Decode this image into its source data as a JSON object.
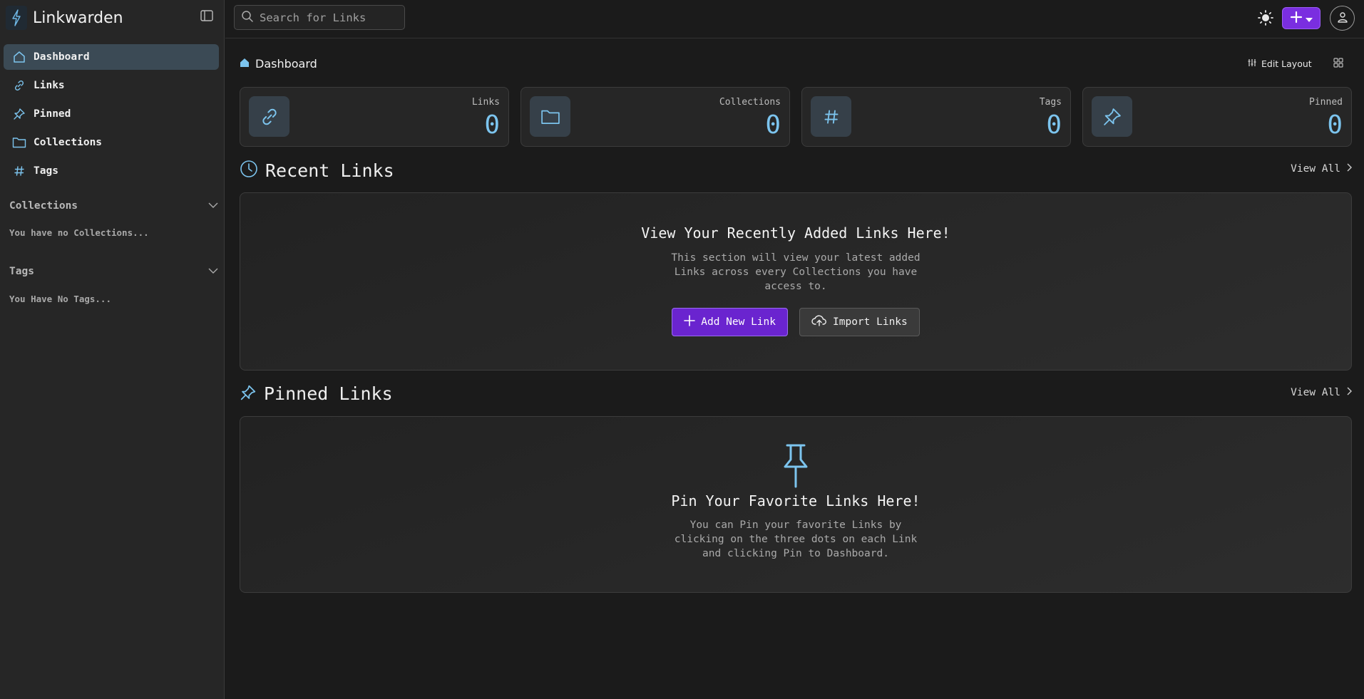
{
  "app": {
    "name": "Linkwarden"
  },
  "sidebar": {
    "items": [
      {
        "label": "Dashboard",
        "icon": "home-icon",
        "active": true
      },
      {
        "label": "Links",
        "icon": "link-icon"
      },
      {
        "label": "Pinned",
        "icon": "pin-icon"
      },
      {
        "label": "Collections",
        "icon": "folder-icon"
      },
      {
        "label": "Tags",
        "icon": "hash-icon"
      }
    ],
    "collections": {
      "title": "Collections",
      "empty": "You have no Collections..."
    },
    "tags": {
      "title": "Tags",
      "empty": "You Have No Tags..."
    }
  },
  "search": {
    "placeholder": "Search for Links"
  },
  "header": {
    "breadcrumb": "Dashboard",
    "edit_layout": "Edit Layout"
  },
  "stats": [
    {
      "label": "Links",
      "value": "0",
      "icon": "link-icon"
    },
    {
      "label": "Collections",
      "value": "0",
      "icon": "folder-icon"
    },
    {
      "label": "Tags",
      "value": "0",
      "icon": "hash-icon"
    },
    {
      "label": "Pinned",
      "value": "0",
      "icon": "pin-icon"
    }
  ],
  "recent": {
    "title": "Recent Links",
    "view_all": "View All",
    "empty_title": "View Your Recently Added Links Here!",
    "empty_text": "This section will view your latest added Links across every Collections you have access to.",
    "add_button": "Add New Link",
    "import_button": "Import Links"
  },
  "pinned": {
    "title": "Pinned Links",
    "view_all": "View All",
    "empty_title": "Pin Your Favorite Links Here!",
    "empty_text": "You can Pin your favorite Links by clicking on the three dots on each Link and clicking Pin to Dashboard."
  },
  "colors": {
    "accent": "#7a2ee0",
    "icon": "#7cc4ee",
    "background": "#1b1b1b",
    "sidebar": "#262626"
  }
}
